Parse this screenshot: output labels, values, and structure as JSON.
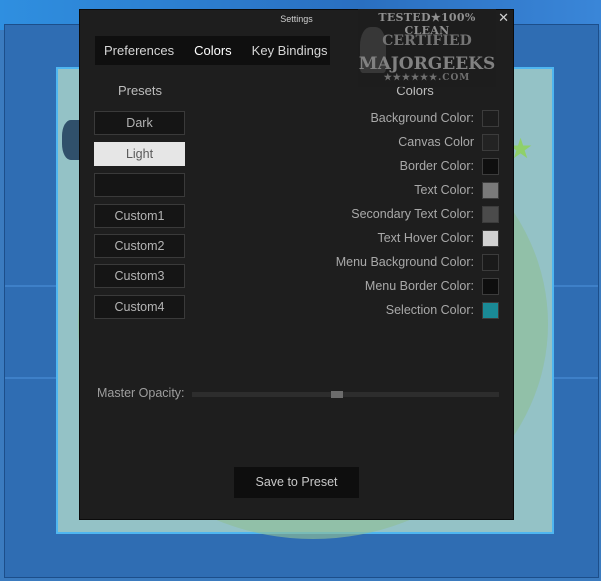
{
  "window": {
    "title": "Settings",
    "close_glyph": "✕"
  },
  "tabs": [
    {
      "label": "Preferences",
      "active": false
    },
    {
      "label": "Colors",
      "active": true
    },
    {
      "label": "Key Bindings",
      "active": false
    }
  ],
  "presets": {
    "title": "Presets",
    "items": [
      {
        "label": "Dark",
        "selected": false
      },
      {
        "label": "Light",
        "selected": true
      },
      {
        "label": "",
        "selected": false
      },
      {
        "label": "Custom1",
        "selected": false
      },
      {
        "label": "Custom2",
        "selected": false
      },
      {
        "label": "Custom3",
        "selected": false
      },
      {
        "label": "Custom4",
        "selected": false
      }
    ]
  },
  "colors": {
    "title": "Colors",
    "rows": [
      {
        "label": "Background Color:",
        "swatch": "#1d1d1d"
      },
      {
        "label": "Canvas Color",
        "swatch": "#232323"
      },
      {
        "label": "Border Color:",
        "swatch": "#0f0f0f"
      },
      {
        "label": "Text Color:",
        "swatch": "#7a7a7a"
      },
      {
        "label": "Secondary Text Color:",
        "swatch": "#4b4b4b"
      },
      {
        "label": "Text Hover Color:",
        "swatch": "#d2d2d2"
      },
      {
        "label": "Menu Background Color:",
        "swatch": "#1a1a1a"
      },
      {
        "label": "Menu Border Color:",
        "swatch": "#0e0e0e"
      },
      {
        "label": "Selection Color:",
        "swatch": "#1a8a96"
      }
    ]
  },
  "opacity": {
    "label": "Master Opacity:",
    "value": 0.47
  },
  "save_button": {
    "label": "Save to Preset"
  },
  "watermark": {
    "line1": "TESTED★100% CLEAN",
    "line2": "CERTIFIED",
    "line3": "MAJORGEEKS",
    "line4": "★★★★★★.COM"
  },
  "theme": {
    "window_bg": "#1e1e1e",
    "accent_selection": "#1a8a96"
  }
}
